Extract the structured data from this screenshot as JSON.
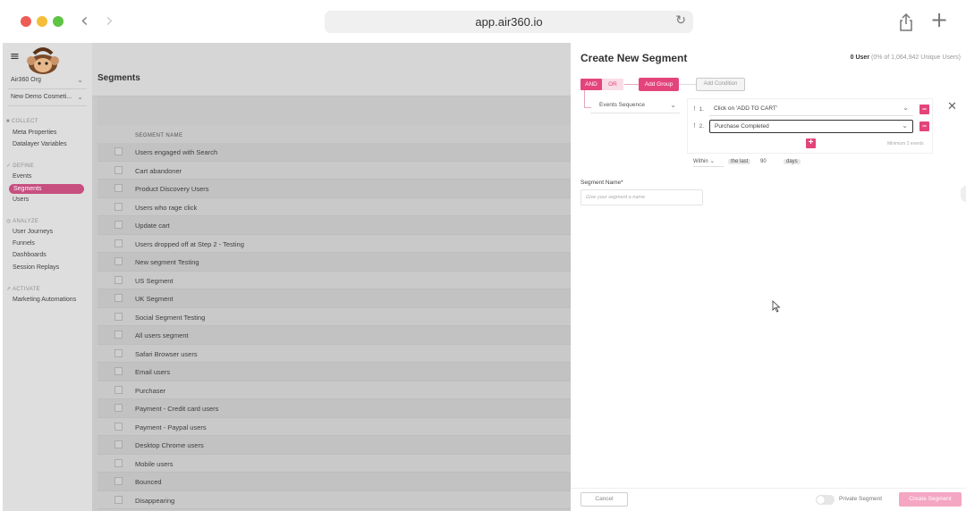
{
  "browser": {
    "url": "app.air360.io"
  },
  "sidebar": {
    "org_select": "Air360 Org",
    "project_select": "New Demo Cosmeti...",
    "sections": [
      {
        "title": "COLLECT",
        "items": [
          "Meta Properties",
          "Datalayer Variables"
        ]
      },
      {
        "title": "DEFINE",
        "items": [
          "Events",
          "Segments",
          "Users"
        ]
      },
      {
        "title": "ANALYZE",
        "items": [
          "User Journeys",
          "Funnels",
          "Dashboards",
          "Session Replays"
        ]
      },
      {
        "title": "ACTIVATE",
        "items": [
          "Marketing Automations"
        ]
      }
    ],
    "active_item": "Segments"
  },
  "main": {
    "title": "Segments",
    "column_header": "SEGMENT NAME",
    "rows": [
      "Users engaged with Search",
      "Cart abandoner",
      "Product Discovery Users",
      "Users who rage click",
      "Update cart",
      "Users dropped off at Step 2 - Testing",
      "New segment Testing",
      "US Segment",
      "UK Segment",
      "Social Segment Testing",
      "All users segment",
      "Safari Browser users",
      "Email users",
      "Purchaser",
      "Payment - Credit card users",
      "Payment - Paypal users",
      "Desktop Chrome users",
      "Mobile users",
      "Bounced",
      "Disappearing"
    ]
  },
  "panel": {
    "title": "Create New Segment",
    "user_count": "0 User",
    "user_count_sub": "(0% of 1,064,942 Unique Users)",
    "and_label": "AND",
    "or_label": "OR",
    "add_group_label": "Add Group",
    "add_condition_label": "Add Condition",
    "events_sequence_label": "Events Sequence",
    "conditions": [
      {
        "num": "1.",
        "value": "Click on 'ADD TO CART'"
      },
      {
        "num": "2.",
        "value": "Purchase Completed"
      }
    ],
    "min_events_note": "Minimum 2 events",
    "within_label": "Within",
    "the_last_label": "the last",
    "days_value": "90",
    "days_unit": "days",
    "segment_name_label": "Segment Name*",
    "segment_name_placeholder": "Give your segment a name",
    "cancel_label": "Cancel",
    "private_label": "Private Segment",
    "create_label": "Create Segment"
  },
  "colors": {
    "accent": "#e4447c",
    "sidebar_active": "#c64f7f"
  }
}
